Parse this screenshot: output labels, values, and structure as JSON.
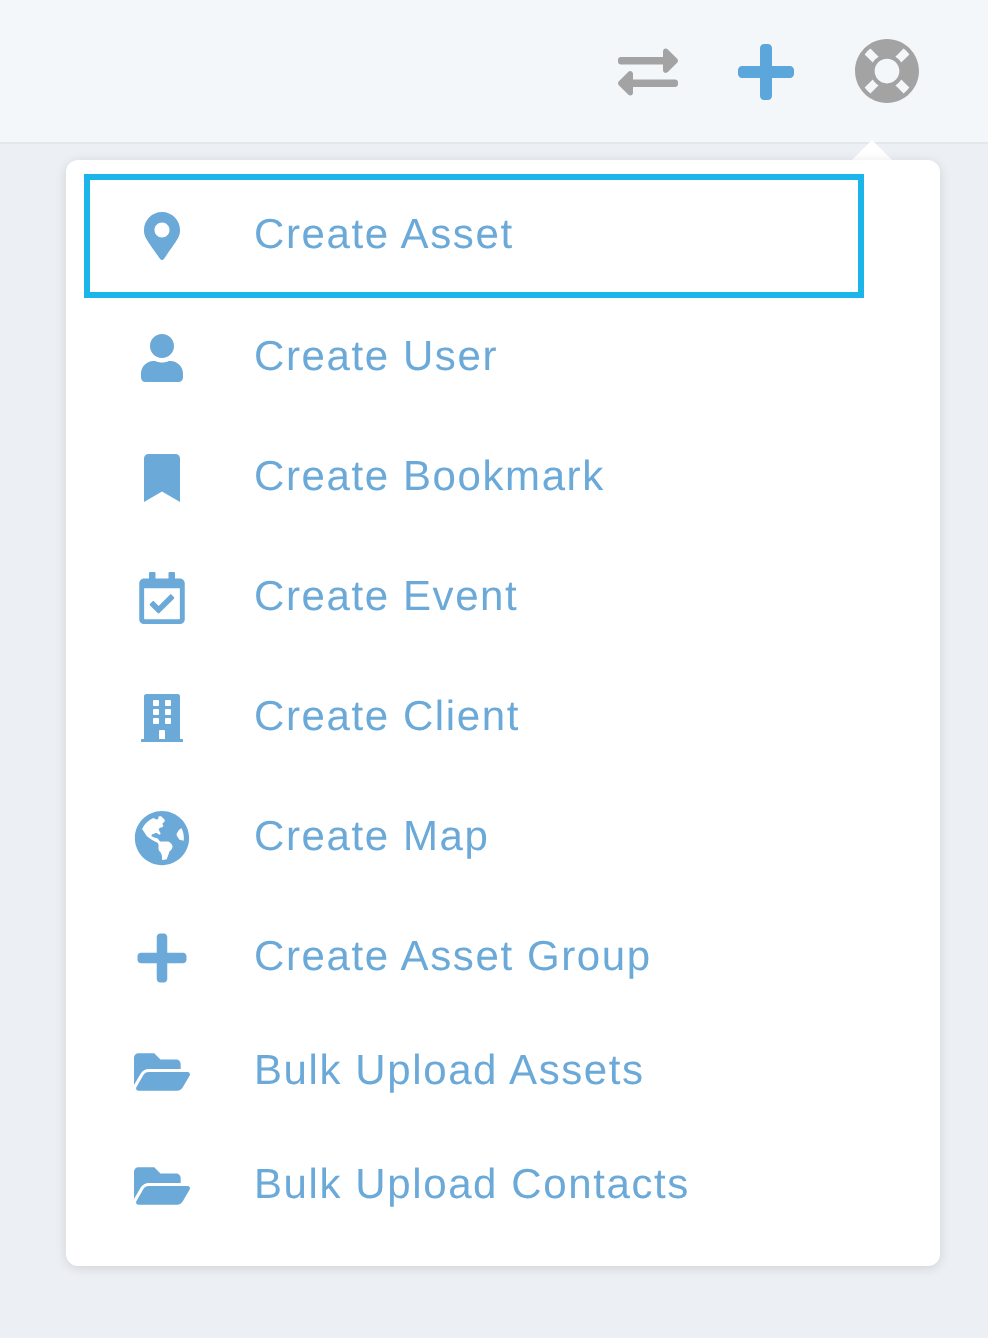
{
  "menu": {
    "items": [
      {
        "label": "Create Asset",
        "selected": true
      },
      {
        "label": "Create User",
        "selected": false
      },
      {
        "label": "Create Bookmark",
        "selected": false
      },
      {
        "label": "Create Event",
        "selected": false
      },
      {
        "label": "Create Client",
        "selected": false
      },
      {
        "label": "Create Map",
        "selected": false
      },
      {
        "label": "Create Asset Group",
        "selected": false
      },
      {
        "label": "Bulk Upload Assets",
        "selected": false
      },
      {
        "label": "Bulk Upload Contacts",
        "selected": false
      }
    ]
  }
}
